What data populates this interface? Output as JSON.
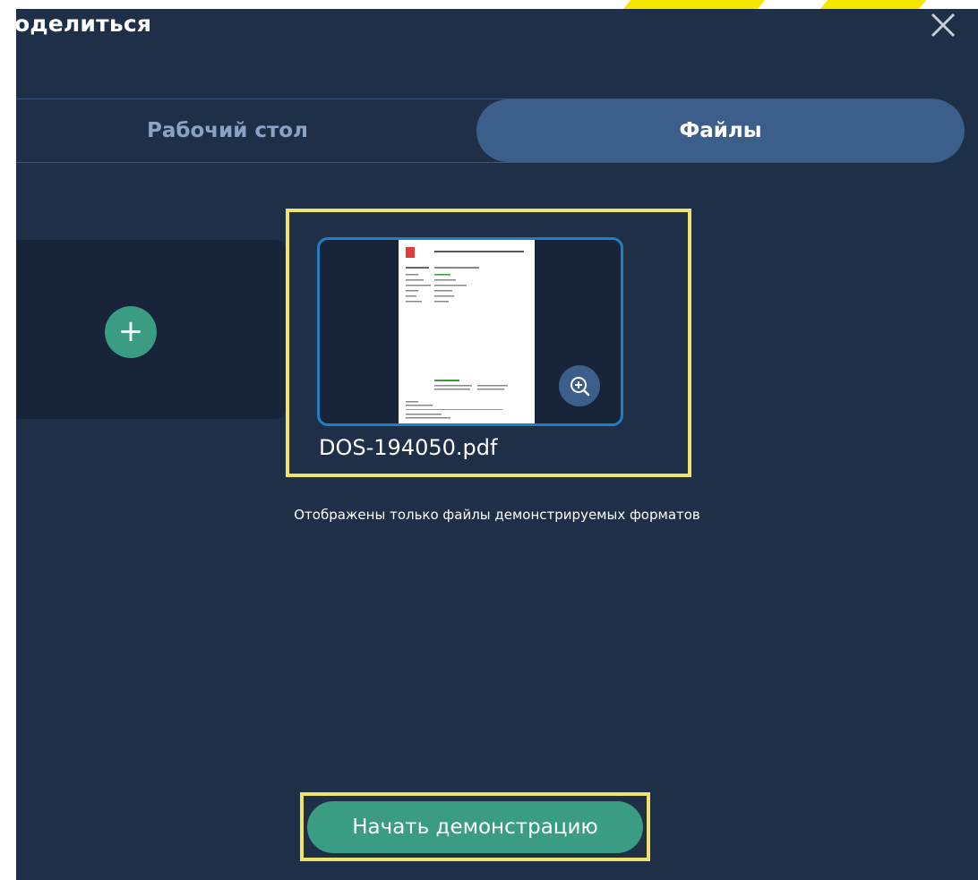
{
  "dialog": {
    "title": "оделиться",
    "close_icon": "close-icon"
  },
  "tabs": [
    {
      "label": "Рабочий стол",
      "active": false
    },
    {
      "label": "Файлы",
      "active": true
    }
  ],
  "files": [
    {
      "name": "DOS-194050.pdf",
      "selected": true
    }
  ],
  "add_icon": "plus-icon",
  "zoom_icon": "zoom-in-icon",
  "hint": "Отображены только файлы демонстрируемых форматов",
  "start_button": "Начать демонстрацию",
  "colors": {
    "background": "#1f2f47",
    "accent": "#3a9d83",
    "active_tab": "#3b5e8b",
    "highlight": "#f0e36a",
    "preview_border": "#1e7fc1"
  }
}
